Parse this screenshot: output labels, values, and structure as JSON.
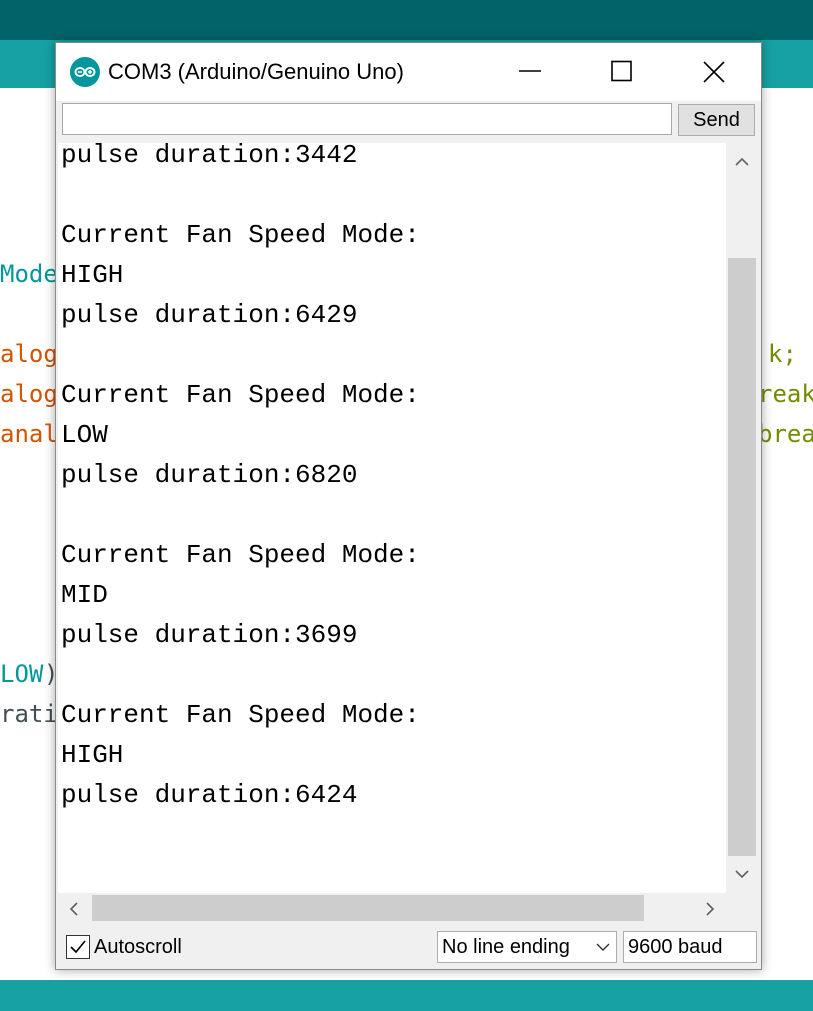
{
  "ide": {
    "code_fragments": [
      {
        "text": "Mode",
        "color": "#00979c"
      },
      {
        "text": "alog",
        "color": "#d35400"
      },
      {
        "text": "alog",
        "color": "#d35400"
      },
      {
        "text": "anal",
        "color": "#d35400"
      },
      {
        "text": "LOW",
        "color": "#00979c"
      },
      {
        "text": ")",
        "color": "#434f54"
      },
      {
        "text": "rati",
        "color": "#434f54"
      },
      {
        "text": "k;",
        "color": "#728e00"
      },
      {
        "text": "reak",
        "color": "#728e00"
      },
      {
        "text": "brea",
        "color": "#728e00"
      }
    ]
  },
  "window": {
    "title": "COM3 (Arduino/Genuino Uno)",
    "logo_icon": "arduino-infinity-icon",
    "controls": [
      "minimize-icon",
      "maximize-icon",
      "close-icon"
    ]
  },
  "input": {
    "value": "",
    "placeholder": "",
    "send_label": "Send"
  },
  "output": {
    "lines": [
      "pulse duration:3442",
      "",
      "Current Fan Speed Mode:",
      "HIGH",
      "pulse duration:6429",
      "",
      "Current Fan Speed Mode:",
      "LOW",
      "pulse duration:6820",
      "",
      "Current Fan Speed Mode:",
      "MID",
      "pulse duration:3699",
      "",
      "Current Fan Speed Mode:",
      "HIGH",
      "pulse duration:6424"
    ]
  },
  "status": {
    "autoscroll_label": "Autoscroll",
    "autoscroll_checked": true,
    "line_ending": "No line ending",
    "baud": "9600 baud"
  },
  "colors": {
    "ide_header": "#006468",
    "ide_toolbar": "#17a1a5",
    "logo": "#00979c"
  }
}
